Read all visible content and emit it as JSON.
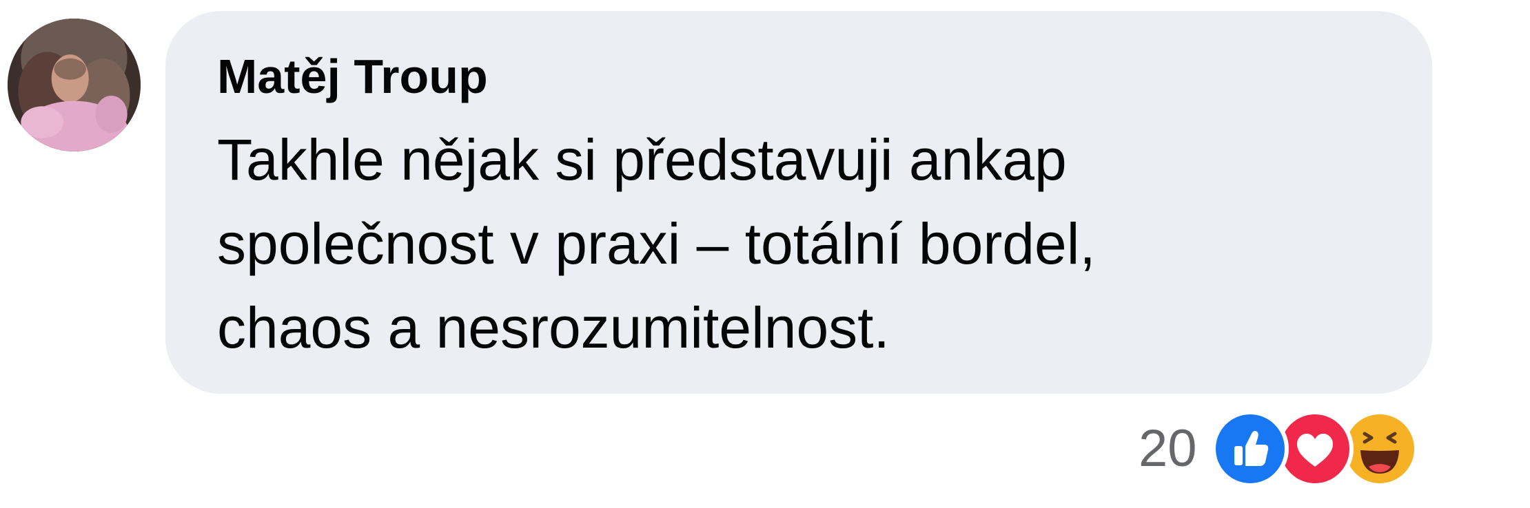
{
  "comment": {
    "author": "Matěj Troup",
    "text_lines": [
      "Takhle nějak si představuji ankap",
      "společnost v praxi – totální bordel,",
      "chaos a nesrozumitelnost."
    ]
  },
  "reactions": {
    "count": "20",
    "types": [
      "like-icon",
      "love-icon",
      "haha-icon"
    ]
  },
  "colors": {
    "bubble": "#ebeef3",
    "like": "#1877f2",
    "love": "#f0284a",
    "haha": "#f7b125",
    "count_text": "#65676b"
  }
}
